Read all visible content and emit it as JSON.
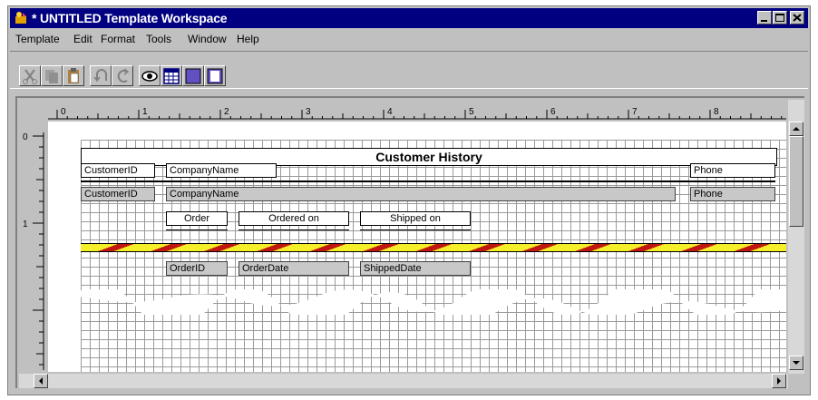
{
  "window": {
    "title": "* UNTITLED Template Workspace",
    "icon": "app-icon",
    "controls": [
      "minimize-icon",
      "maximize-icon",
      "close-icon"
    ]
  },
  "menu": {
    "items": [
      "Template",
      "Edit",
      "Format",
      "Tools",
      "Window",
      "Help"
    ]
  },
  "toolbar": {
    "buttons": [
      "cut-icon",
      "copy-icon",
      "paste-icon",
      "undo-icon",
      "redo-icon",
      "preview-icon",
      "table-icon",
      "fill-icon",
      "page-icon"
    ]
  },
  "ruler": {
    "horizontal_labels": [
      "0",
      "1",
      "2",
      "3",
      "4",
      "5",
      "6",
      "7",
      "8"
    ],
    "vertical_labels": [
      "0",
      "1"
    ]
  },
  "report": {
    "title": "Customer History",
    "header_labels": {
      "customer_id": "CustomerID",
      "company_name": "CompanyName",
      "phone": "Phone"
    },
    "data_fields": {
      "customer_id": "CustomerID",
      "company_name": "CompanyName",
      "phone": "Phone"
    },
    "order_labels": {
      "order": "Order",
      "ordered_on": "Ordered on",
      "shipped_on": "Shipped on"
    },
    "order_fields": {
      "order_id": "OrderID",
      "order_date": "OrderDate",
      "shipped_date": "ShippedDate"
    }
  },
  "colors": {
    "titlebar": "#000080",
    "chrome": "#c0c0c0",
    "page_break_yellow": "#f5ef2a",
    "page_break_red": "#c01810",
    "data_field": "#c8c8c8"
  }
}
